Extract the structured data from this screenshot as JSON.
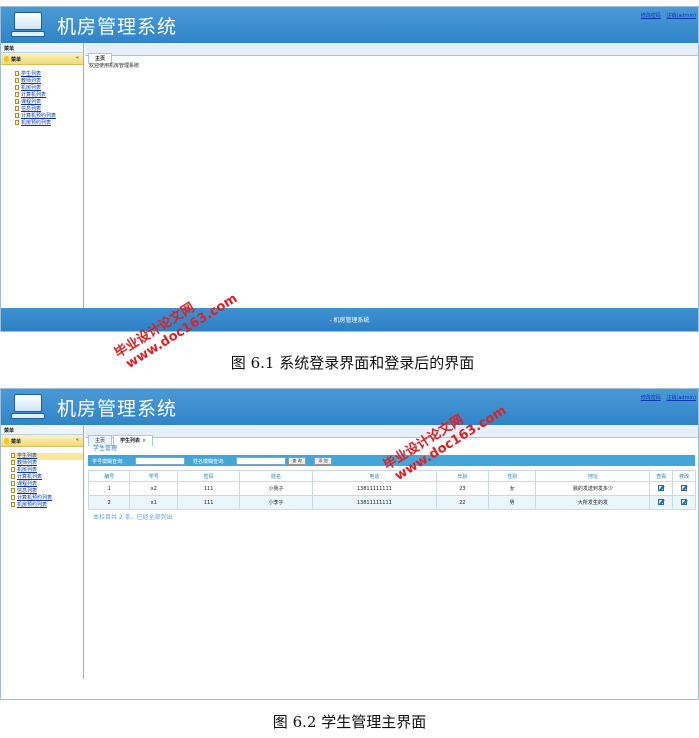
{
  "app": {
    "title": "机房管理系统",
    "top_links": [
      "修改密码",
      "注销(admin)"
    ]
  },
  "sidebar": {
    "panel_title": "菜单",
    "group_title": "菜单",
    "items": [
      "学生列表",
      "教师列表",
      "机房列表",
      "计算机列表",
      "课程列表",
      "信息列表",
      "计算机预约列表",
      "机房预约列表"
    ]
  },
  "screen1": {
    "tabs": [
      "主页"
    ],
    "welcome": "欢迎使用机房管理系统",
    "footer": "- 机房管理系统"
  },
  "screen2": {
    "tabs": [
      {
        "label": "主页"
      },
      {
        "label": "学生列表",
        "close": "×"
      }
    ],
    "panel_title": "学生管理",
    "search": {
      "student_no_label": "学号模糊查询:",
      "name_label": "姓名模糊查询:",
      "search_button": "查 询",
      "add_button": "添 加"
    },
    "table": {
      "headers": [
        "编号",
        "学号",
        "密码",
        "姓名",
        "电话",
        "年龄",
        "性别",
        "地址",
        "查看",
        "修改"
      ],
      "rows": [
        [
          "1",
          "x2",
          "111",
          "小我子",
          "13811111111",
          "23",
          "女",
          "晨的发送到发多少"
        ],
        [
          "2",
          "x1",
          "111",
          "小李子",
          "13811111111",
          "22",
          "男",
          "大所发生的发"
        ]
      ]
    },
    "summary": "本栏目共 2 条，已经全部列出"
  },
  "captions": {
    "fig1": "图 6.1  系统登录界面和登录后的界面",
    "fig2": "图 6.2  学生管理主界面"
  },
  "watermark": {
    "line1": "毕业设计论文网",
    "line2": "www.doc163.com"
  },
  "colors": {
    "header_blue": "#3489cc",
    "sidebar_active": "#fbe79a",
    "link": "#0a36b3",
    "watermark": "#e02020"
  }
}
